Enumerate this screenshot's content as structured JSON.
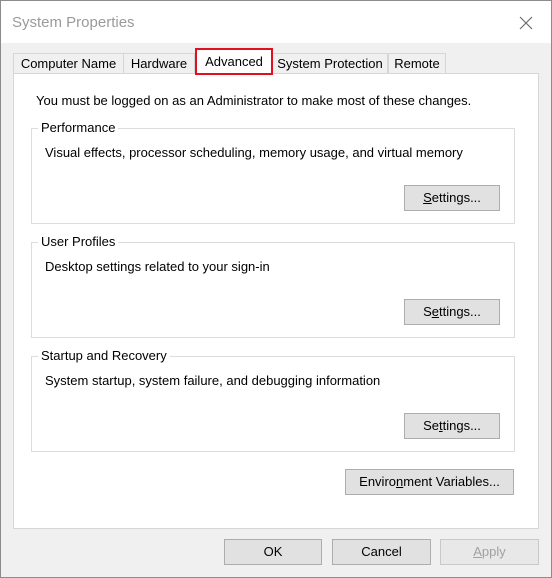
{
  "window": {
    "title": "System Properties"
  },
  "tabs": [
    {
      "label": "Computer Name"
    },
    {
      "label": "Hardware"
    },
    {
      "label": "Advanced"
    },
    {
      "label": "System Protection"
    },
    {
      "label": "Remote"
    }
  ],
  "panel": {
    "notice": "You must be logged on as an Administrator to make most of these changes."
  },
  "groups": {
    "performance": {
      "title": "Performance",
      "description": "Visual effects, processor scheduling, memory usage, and virtual memory",
      "button_prefix": "",
      "button_mnemonic": "S",
      "button_suffix": "ettings..."
    },
    "user_profiles": {
      "title": "User Profiles",
      "description": "Desktop settings related to your sign-in",
      "button_prefix": "S",
      "button_mnemonic": "e",
      "button_suffix": "ttings..."
    },
    "startup_recovery": {
      "title": "Startup and Recovery",
      "description": "System startup, system failure, and debugging information",
      "button_prefix": "Se",
      "button_mnemonic": "t",
      "button_suffix": "tings..."
    }
  },
  "env_button": {
    "prefix": "Enviro",
    "mnemonic": "n",
    "suffix": "ment Variables..."
  },
  "footer": {
    "ok_label": "OK",
    "cancel_label": "Cancel",
    "apply_prefix": "",
    "apply_mnemonic": "A",
    "apply_suffix": "pply"
  },
  "colors": {
    "highlight_border": "#e01020",
    "window_bg": "#f0f0f0",
    "panel_bg": "#ffffff",
    "disabled_text": "#a0a0a0"
  },
  "icons": {
    "close": "close-icon"
  },
  "state": {
    "active_tab": "Advanced",
    "apply_enabled": false
  }
}
